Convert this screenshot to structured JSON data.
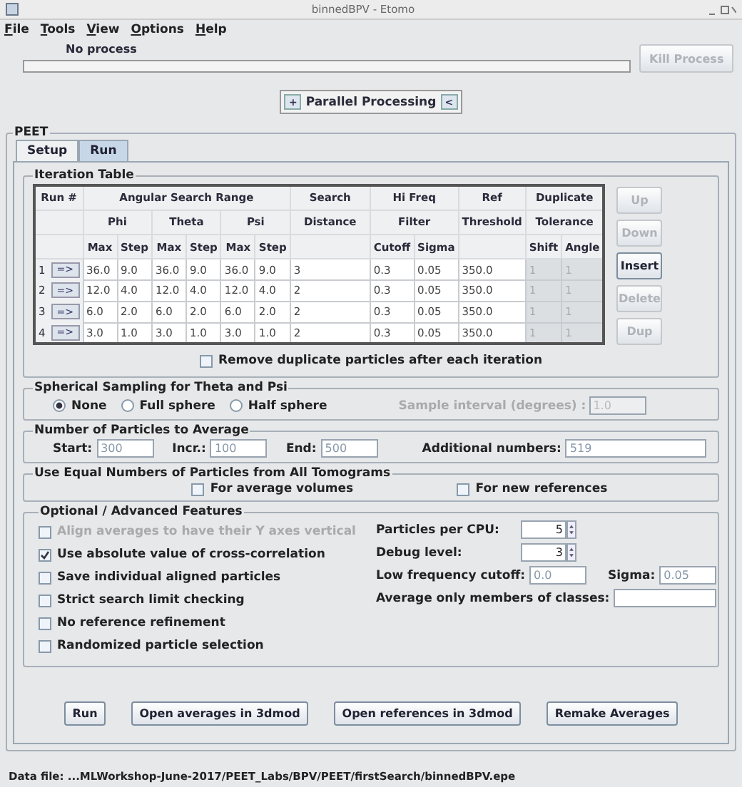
{
  "window": {
    "title": "binnedBPV - Etomo"
  },
  "menu": [
    "File",
    "Tools",
    "View",
    "Options",
    "Help"
  ],
  "process": {
    "status": "No process",
    "level": 0,
    "kill_button": {
      "label": "Kill Process",
      "disabled": true
    }
  },
  "parallel_button": {
    "left": "+",
    "label": "Parallel Processing",
    "right": "<"
  },
  "peet": {
    "title": "PEET",
    "tabs": [
      {
        "label": "Setup",
        "selected": false
      },
      {
        "label": "Run",
        "selected": true
      }
    ],
    "iteration_table": {
      "title": "Iteration Table",
      "header_rows": [
        [
          "Run #",
          "Angular Search Range",
          "Search",
          "Hi Freq",
          "Ref",
          "Duplicate"
        ],
        [
          null,
          "Phi",
          "Theta",
          "Psi",
          "Distance",
          "Filter",
          "Threshold",
          "Tolerance"
        ],
        [
          null,
          "Max",
          "Step",
          "Max",
          "Step",
          "Max",
          "Step",
          null,
          "Cutoff",
          "Sigma",
          null,
          "Shift",
          "Angle"
        ]
      ],
      "rows": [
        {
          "run": "1",
          "button": "=>",
          "cells": [
            "36.0",
            "9.0",
            "36.0",
            "9.0",
            "36.0",
            "9.0",
            "3",
            "0.3",
            "0.05",
            "350.0"
          ],
          "tolerance": [
            "1",
            "1"
          ],
          "tolerance_disabled": true
        },
        {
          "run": "2",
          "button": "=>",
          "cells": [
            "12.0",
            "4.0",
            "12.0",
            "4.0",
            "12.0",
            "4.0",
            "2",
            "0.3",
            "0.05",
            "350.0"
          ],
          "tolerance": [
            "1",
            "1"
          ],
          "tolerance_disabled": true
        },
        {
          "run": "3",
          "button": "=>",
          "cells": [
            "6.0",
            "2.0",
            "6.0",
            "2.0",
            "6.0",
            "2.0",
            "2",
            "0.3",
            "0.05",
            "350.0"
          ],
          "tolerance": [
            "1",
            "1"
          ],
          "tolerance_disabled": true
        },
        {
          "run": "4",
          "button": "=>",
          "cells": [
            "3.0",
            "1.0",
            "3.0",
            "1.0",
            "3.0",
            "1.0",
            "2",
            "0.3",
            "0.05",
            "350.0"
          ],
          "tolerance": [
            "1",
            "1"
          ],
          "tolerance_disabled": true
        }
      ],
      "side_buttons": [
        {
          "label": "Up",
          "disabled": true
        },
        {
          "label": "Down",
          "disabled": true
        },
        {
          "label": "Insert",
          "disabled": false
        },
        {
          "label": "Delete",
          "disabled": true
        },
        {
          "label": "Dup",
          "disabled": true
        }
      ],
      "remove_duplicates": {
        "label": "Remove duplicate particles after each iteration",
        "checked": false
      }
    },
    "spherical": {
      "title": "Spherical Sampling for Theta and Psi",
      "options": [
        {
          "label": "None",
          "selected": true
        },
        {
          "label": "Full sphere",
          "selected": false
        },
        {
          "label": "Half sphere",
          "selected": false
        }
      ],
      "sample_interval": {
        "label": "Sample interval (degrees) :",
        "value": "1.0",
        "disabled": true
      }
    },
    "particles": {
      "title": "Number of Particles to Average",
      "fields": [
        {
          "label": "Start:",
          "value": "300"
        },
        {
          "label": "Incr.:",
          "value": "100"
        },
        {
          "label": "End:",
          "value": "500"
        },
        {
          "label": "Additional numbers:",
          "value": "519"
        }
      ]
    },
    "equal": {
      "title": "Use Equal Numbers of Particles from All Tomograms",
      "checkboxes": [
        {
          "label": "For average volumes",
          "checked": false
        },
        {
          "label": "For new references",
          "checked": false
        }
      ]
    },
    "optional": {
      "title": "Optional / Advanced Features",
      "checkboxes": [
        {
          "label": "Align averages to have their Y axes vertical",
          "checked": false,
          "disabled": true
        },
        {
          "label": "Use absolute value of cross-correlation",
          "checked": true,
          "disabled": false
        },
        {
          "label": "Save individual aligned particles",
          "checked": false,
          "disabled": false
        },
        {
          "label": "Strict search limit checking",
          "checked": false,
          "disabled": false
        },
        {
          "label": "No reference refinement",
          "checked": false,
          "disabled": false
        },
        {
          "label": "Randomized particle selection",
          "checked": false,
          "disabled": false
        }
      ],
      "particles_per_cpu": {
        "label": "Particles per CPU:",
        "value": "5"
      },
      "debug_level": {
        "label": "Debug level:",
        "value": "3"
      },
      "low_frequency_cutoff": {
        "label": "Low frequency cutoff:",
        "value": "0.0"
      },
      "sigma": {
        "label": "Sigma:",
        "value": "0.05"
      },
      "average_only": {
        "label": "Average only members of classes:"
      }
    },
    "actions": [
      "Run",
      "Open averages in 3dmod",
      "Open references in 3dmod",
      "Remake Averages"
    ]
  },
  "status_bar": "Data file: ...MLWorkshop-June-2017/PEET_Labs/BPV/PEET/firstSearch/binnedBPV.epe"
}
